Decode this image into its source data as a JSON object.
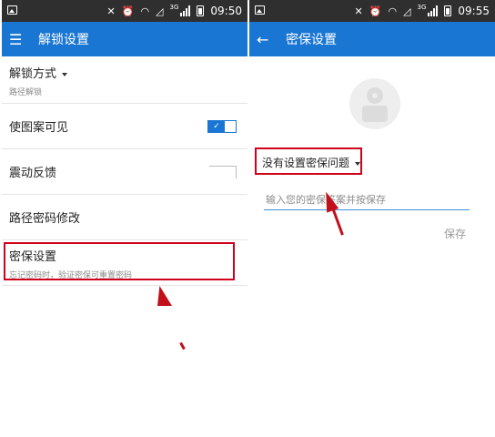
{
  "status_bar": {
    "left_time": "09:50",
    "right_time": "09:55",
    "network": "3G"
  },
  "left_screen": {
    "title": "解锁设置",
    "rows": [
      {
        "label": "解锁方式",
        "sub": "路径解锁"
      },
      {
        "label": "使图案可见"
      },
      {
        "label": "震动反馈"
      },
      {
        "label": "路径密码修改"
      },
      {
        "label": "密保设置",
        "sub": "忘记密码时，验证密保可重置密码"
      }
    ],
    "visible_pattern_on": true,
    "vibration_on": false
  },
  "right_screen": {
    "title": "密保设置",
    "question_label": "没有设置密保问题",
    "answer_placeholder": "输入您的密保答案并按保存",
    "save_label": "保存"
  },
  "colors": {
    "app_bar": "#1976d2",
    "status_bar": "#2f2f2f",
    "highlight": "#d0021b",
    "arrow": "#c0101a"
  },
  "icons": {
    "menu": "hamburger-icon",
    "back": "arrow-left-icon"
  }
}
